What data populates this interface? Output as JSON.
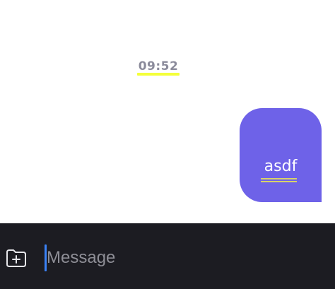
{
  "chat": {
    "timestamp": "09:52",
    "messages": [
      {
        "text": "asdf",
        "direction": "outgoing"
      }
    ]
  },
  "composer": {
    "input_value": "",
    "input_placeholder": "Message",
    "attach_icon": "folder-plus-icon"
  },
  "colors": {
    "bubble": "#6e62e8",
    "composer_bg": "#1c1c22",
    "caret": "#3b82f6",
    "highlight": "#f4ff3a"
  }
}
